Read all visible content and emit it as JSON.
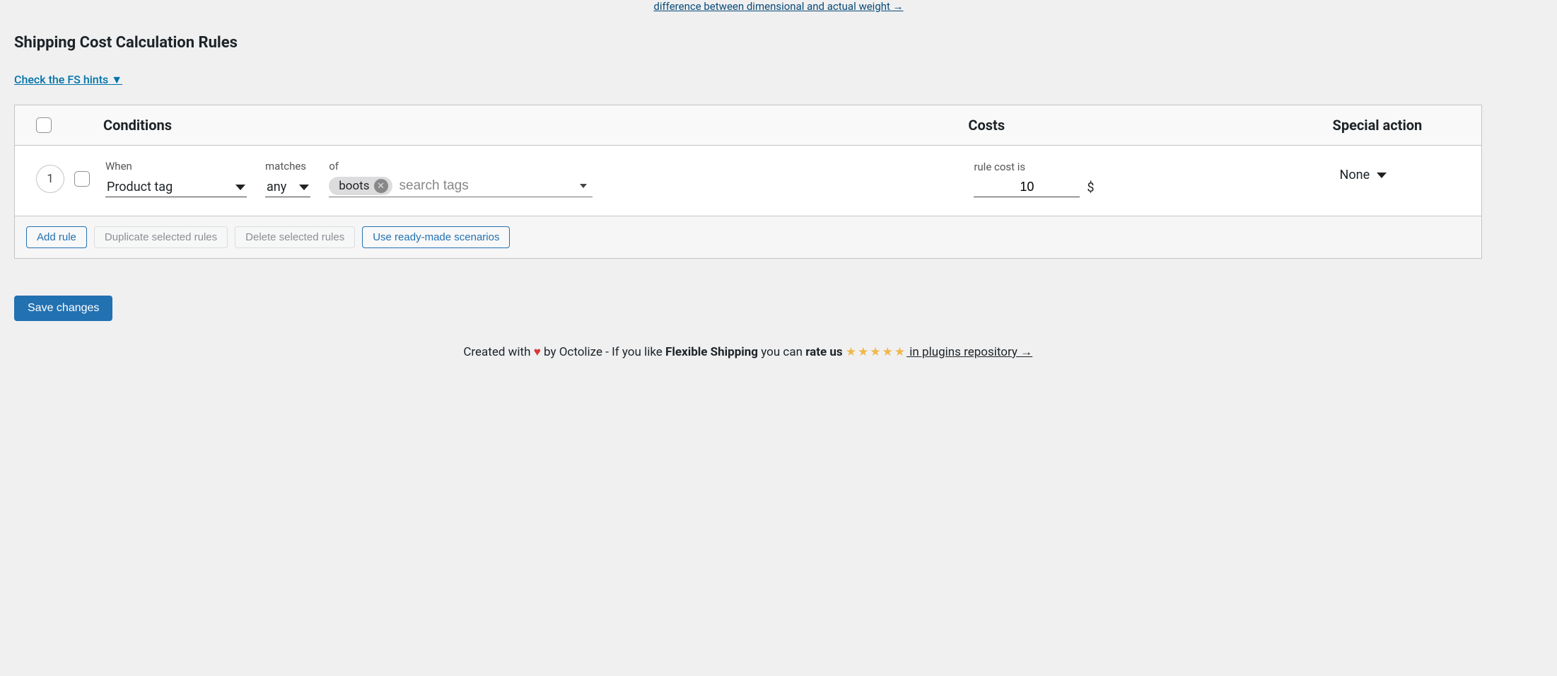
{
  "top_partial_link": "difference between dimensional and actual weight →",
  "section_title": "Shipping Cost Calculation Rules",
  "hints_link": "Check the FS hints",
  "hints_caret": "▼",
  "table": {
    "headers": {
      "conditions": "Conditions",
      "costs": "Costs",
      "special_action": "Special action"
    }
  },
  "row": {
    "number": "1",
    "labels": {
      "when": "When",
      "matches": "matches",
      "of": "of",
      "rule_cost_is": "rule cost is"
    },
    "when_value": "Product tag",
    "matches_value": "any",
    "tag_value": "boots",
    "search_placeholder": "search tags",
    "cost_value": "10",
    "currency": "$",
    "special_value": "None"
  },
  "actions": {
    "add_rule": "Add rule",
    "duplicate": "Duplicate selected rules",
    "delete": "Delete selected rules",
    "use_scenarios": "Use ready-made scenarios"
  },
  "save_button": "Save changes",
  "footer": {
    "created_with": "Created with ",
    "heart": "♥",
    "by": " by Octolize - If you like ",
    "product": "Flexible Shipping",
    "rate_text": " you can ",
    "rate_us": "rate us ",
    "stars": "★★★★★",
    "repo_link": " in plugins repository →"
  }
}
